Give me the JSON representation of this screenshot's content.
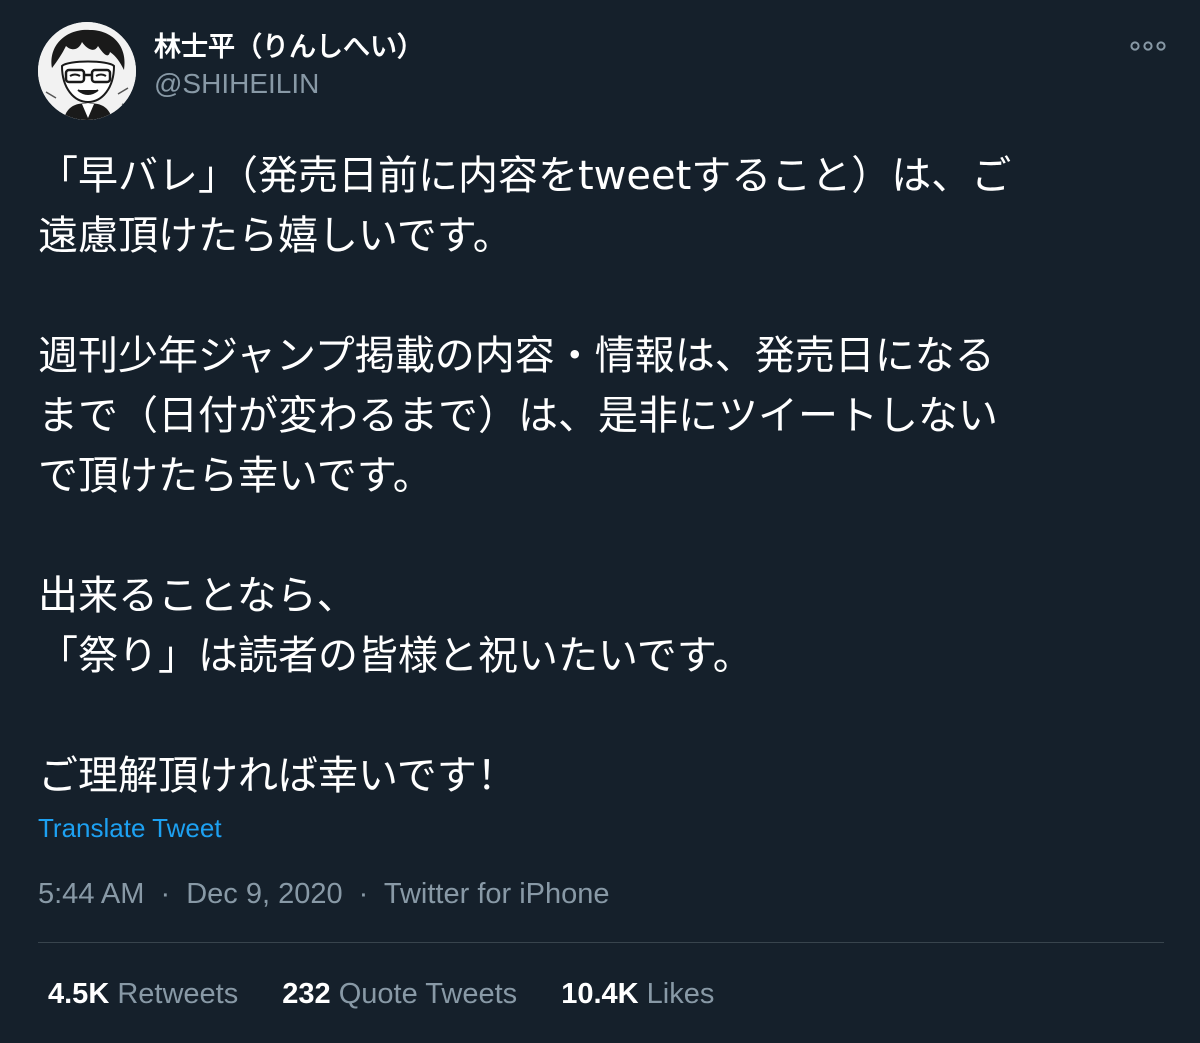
{
  "colors": {
    "background": "#15202b",
    "text_primary": "#ffffff",
    "text_secondary": "#8899a6",
    "link": "#1da1f2",
    "divider": "#38444d"
  },
  "author": {
    "display_name": "林士平（りんしへい）",
    "handle": "@SHIHEILIN",
    "avatar_icon": "avatar-illustration-icon"
  },
  "more_icon": "more-options-icon",
  "tweet": {
    "lines": [
      "「早バレ」（発売日前に内容をtweetすること）は、ご",
      "遠慮頂けたら嬉しいです。",
      "",
      "週刊少年ジャンプ掲載の内容・情報は、発売日になる",
      "まで（日付が変わるまで）は、是非にツイートしない",
      "で頂けたら幸いです。",
      "",
      "出来ることなら、",
      "「祭り」は読者の皆様と祝いたいです。",
      "",
      "ご理解頂ければ幸いです！"
    ]
  },
  "translate_label": "Translate Tweet",
  "meta": {
    "time": "5:44 AM",
    "date": "Dec 9, 2020",
    "separator": "·",
    "source": "Twitter for iPhone"
  },
  "stats": [
    {
      "number": "4.5K",
      "label": "Retweets"
    },
    {
      "number": "232",
      "label": "Quote Tweets"
    },
    {
      "number": "10.4K",
      "label": "Likes"
    }
  ]
}
